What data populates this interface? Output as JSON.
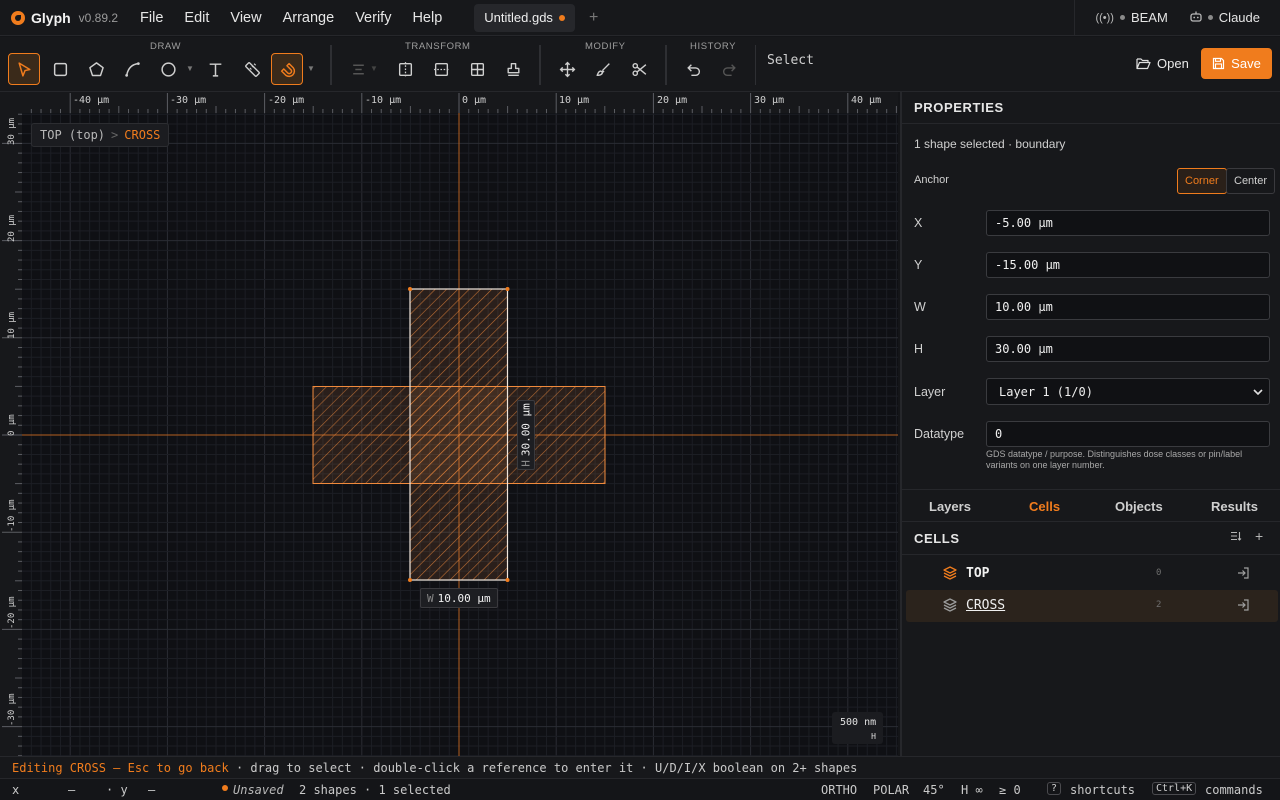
{
  "app": {
    "name": "Glyph",
    "version": "v0.89.2"
  },
  "menu": [
    "File",
    "Edit",
    "View",
    "Arrange",
    "Verify",
    "Help"
  ],
  "file_tab": {
    "name": "Untitled.gds"
  },
  "status": {
    "beam": "BEAM",
    "claude": "Claude"
  },
  "toolbar": {
    "groups": {
      "draw": "DRAW",
      "transform": "TRANSFORM",
      "modify": "MODIFY",
      "history": "HISTORY"
    },
    "mode": "Select",
    "open_label": "Open",
    "save_label": "Save",
    "accent": "#f07c1d"
  },
  "ruler": {
    "x_ticks": [
      "-40 µm",
      "-30 µm",
      "-20 µm",
      "-10 µm",
      "0 µm",
      "10 µm",
      "20 µm",
      "30 µm",
      "40 µm"
    ],
    "y_ticks": [
      "30 µm",
      "20 µm",
      "10 µm",
      "0 µm",
      "-10 µm",
      "-20 µm",
      "-30 µm"
    ]
  },
  "breadcrumb": {
    "top": "TOP (top)",
    "separator": ">",
    "current": "CROSS"
  },
  "canvas": {
    "scale": "500 nm",
    "scale_axis": "H",
    "w_key": "W",
    "w_value": "10.00 µm",
    "h_key": "H",
    "h_value": "30.00 µm"
  },
  "properties": {
    "title": "PROPERTIES",
    "selection": "1 shape selected · boundary",
    "anchor_label": "Anchor",
    "anchor_options": [
      "Corner",
      "Center"
    ],
    "anchor_selected": "Corner",
    "fields": [
      {
        "label": "X",
        "value": "-5.00 µm"
      },
      {
        "label": "Y",
        "value": "-15.00 µm"
      },
      {
        "label": "W",
        "value": "10.00 µm"
      },
      {
        "label": "H",
        "value": "30.00 µm"
      }
    ],
    "layer_label": "Layer",
    "layer_value": "Layer 1 (1/0)",
    "datatype_label": "Datatype",
    "datatype_value": "0",
    "datatype_help": "GDS datatype / purpose. Distinguishes dose classes or pin/label variants on one layer number."
  },
  "panel_tabs": [
    "Layers",
    "Cells",
    "Objects",
    "Results"
  ],
  "panel_tab_active": "Cells",
  "cells": {
    "title": "CELLS",
    "items": [
      {
        "name": "TOP",
        "count": "0"
      },
      {
        "name": "CROSS",
        "count": "2"
      }
    ]
  },
  "hint": {
    "prefix": "Editing CROSS — Esc to go back",
    "rest": " · drag to select · double-click a reference to enter it · U/D/I/X boolean on 2+ shapes"
  },
  "statusbar": {
    "x_label": "x",
    "x_value": "—",
    "y_label": "· y",
    "y_value": "—",
    "unsaved": "Unsaved",
    "shapes": "2 shapes · 1 selected",
    "ortho": "ORTHO",
    "polar": "POLAR",
    "angle": "45°",
    "h": "H ∞",
    "ge": "≥ 0",
    "shortcuts_key": "?",
    "shortcuts": "shortcuts",
    "commands_key": "Ctrl+K",
    "commands": "commands"
  }
}
